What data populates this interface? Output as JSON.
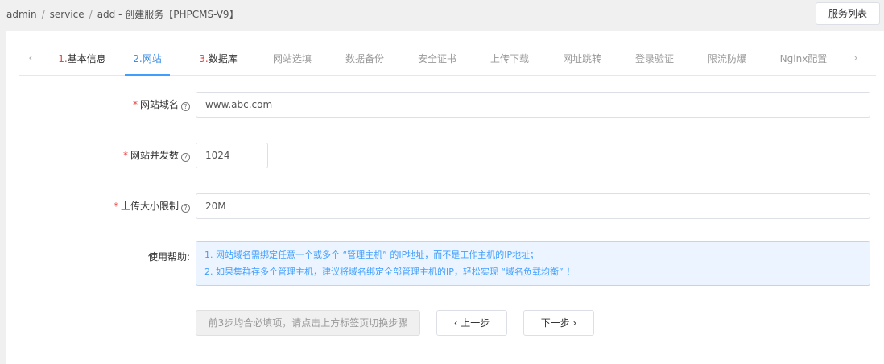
{
  "breadcrumb": {
    "items": [
      "admin",
      "service",
      "add"
    ],
    "separator": "/",
    "title": "- 创建服务【PHPCMS-V9】"
  },
  "header": {
    "list_button": "服务列表"
  },
  "tabs": [
    {
      "num": "1.",
      "label": "基本信息"
    },
    {
      "num": "2.",
      "label": "网站"
    },
    {
      "num": "3.",
      "label": "数据库"
    },
    {
      "num": "",
      "label": "网站选填"
    },
    {
      "num": "",
      "label": "数据备份"
    },
    {
      "num": "",
      "label": "安全证书"
    },
    {
      "num": "",
      "label": "上传下载"
    },
    {
      "num": "",
      "label": "网址跳转"
    },
    {
      "num": "",
      "label": "登录验证"
    },
    {
      "num": "",
      "label": "限流防爆"
    },
    {
      "num": "",
      "label": "Nginx配置"
    }
  ],
  "tab_arrows": {
    "left": "‹",
    "right": "›"
  },
  "form": {
    "required_mark": "*",
    "help_glyph": "?",
    "domain": {
      "label": "网站域名",
      "value": "www.abc.com"
    },
    "concurrency": {
      "label": "网站并发数",
      "value": "1024"
    },
    "upload_limit": {
      "label": "上传大小限制",
      "value": "20M"
    },
    "help": {
      "label": "使用帮助:",
      "line1": "1. 网站域名需绑定任意一个或多个 “管理主机” 的IP地址，而不是工作主机的IP地址；",
      "line2": "2. 如果集群存多个管理主机，建议将域名绑定全部管理主机的IP，轻松实现 “域名负载均衡” ！"
    }
  },
  "buttons": {
    "hint": "前3步均合必填项，请点击上方标签页切换步骤",
    "prev": "‹  上一步",
    "next": "下一步  ›"
  }
}
